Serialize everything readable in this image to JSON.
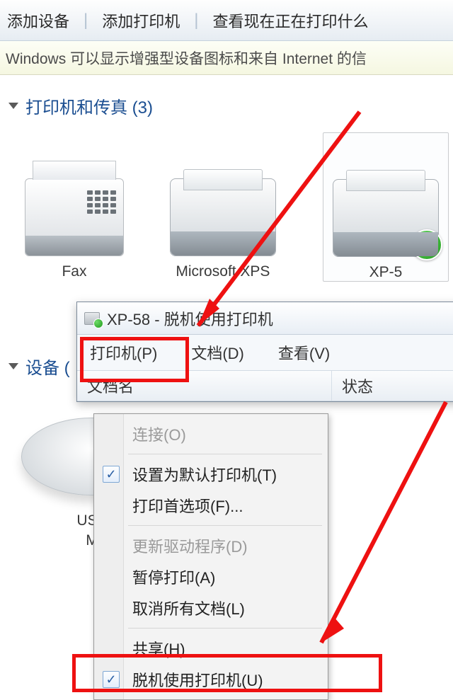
{
  "toolbar": {
    "add_device": "添加设备",
    "add_printer": "添加打印机",
    "view_printing": "查看现在正在打印什么"
  },
  "infobar": "Windows 可以显示增强型设备图标和来自 Internet 的信",
  "section_printers": {
    "title": "打印机和传真 (3)",
    "devices": [
      {
        "label": "Fax",
        "icon": "fax-icon"
      },
      {
        "label": "Microsoft XPS",
        "icon": "printer-icon"
      },
      {
        "label": "XP-5",
        "icon": "printer-icon",
        "default": true
      }
    ]
  },
  "section_devices": {
    "title": "设备 (",
    "usb_label_line1": "USB",
    "usb_label_line2": "M"
  },
  "queue": {
    "title": "XP-58  -  脱机使用打印机",
    "menu": {
      "printer": "打印机(P)",
      "document": "文档(D)",
      "view": "查看(V)"
    },
    "columns": {
      "docname": "文档名",
      "status": "状态"
    }
  },
  "dropdown": {
    "items": [
      {
        "key": "connect",
        "label": "连接(O)",
        "enabled": false,
        "checked": false
      },
      {
        "key": "set_default",
        "label": "设置为默认打印机(T)",
        "enabled": true,
        "checked": true
      },
      {
        "key": "preferences",
        "label": "打印首选项(F)...",
        "enabled": true,
        "checked": false
      },
      {
        "key": "update_driver",
        "label": "更新驱动程序(D)",
        "enabled": false,
        "checked": false
      },
      {
        "key": "pause",
        "label": "暂停打印(A)",
        "enabled": true,
        "checked": false
      },
      {
        "key": "cancel_all",
        "label": "取消所有文档(L)",
        "enabled": true,
        "checked": false
      },
      {
        "key": "share",
        "label": "共享(H)",
        "enabled": true,
        "checked": false
      },
      {
        "key": "use_offline",
        "label": "脱机使用打印机(U)",
        "enabled": true,
        "checked": true
      }
    ]
  }
}
